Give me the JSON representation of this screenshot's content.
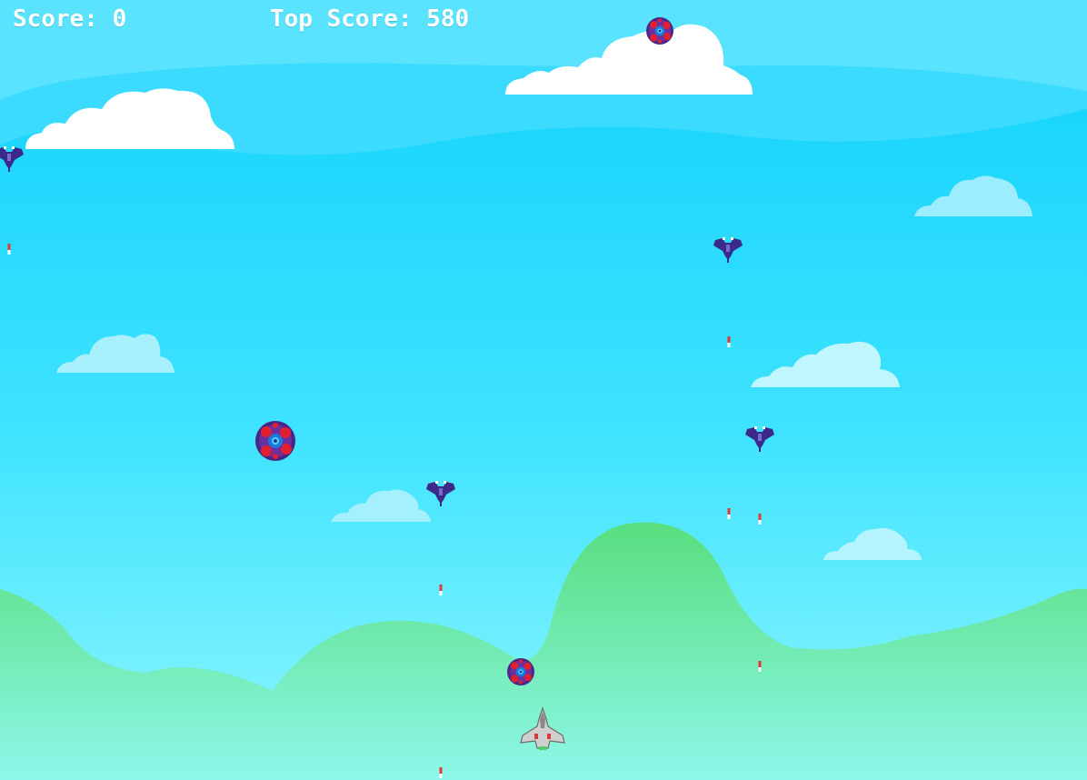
{
  "hud": {
    "score_label": "Score: 0",
    "top_score_label": "Top Score: 580"
  },
  "game_state": {
    "score": 0,
    "top_score": 580,
    "player_lives_visible": 1
  },
  "palette": {
    "sky_top": "#1ecff7",
    "sky_bottom": "#7cf2ff",
    "far_band": "#5ce3ff",
    "hill_front": "#86f0d5",
    "hill_mid": "#5ee08a",
    "cloud_white": "#ffffff",
    "cloud_pale": "#b8f2ff",
    "enemy_jet": "#3b2a8a",
    "mine_outer": "#5a2a90",
    "mine_red": "#e02030",
    "mine_core": "#1a7ad8",
    "bullet": "#e03a3a",
    "player_body": "#c9c9c9"
  },
  "icons": {
    "player": "fighter-jet-icon",
    "enemy": "enemy-jet-icon",
    "mine": "spiked-mine-icon",
    "bullet": "bullet-icon",
    "cloud": "cloud-icon"
  }
}
